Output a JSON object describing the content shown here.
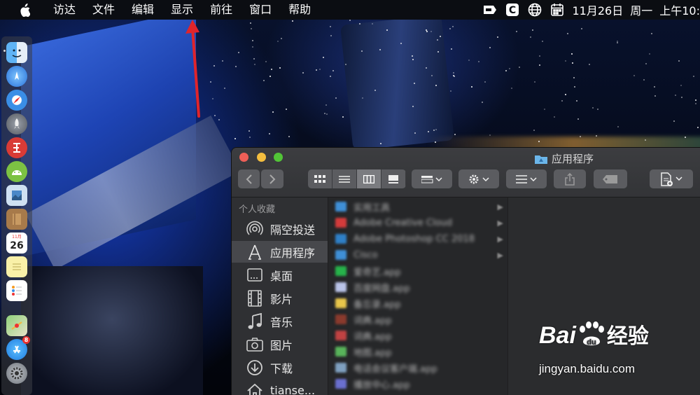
{
  "menubar": {
    "apple_icon": "apple-logo-icon",
    "items": [
      "访达",
      "文件",
      "编辑",
      "显示",
      "前往",
      "窗口",
      "帮助"
    ],
    "status_icons": [
      "notification-icon",
      "c-app-icon",
      "globe-icon",
      "calendar-icon"
    ],
    "date": "11月26日",
    "weekday": "周一",
    "time": "上午10:"
  },
  "dock": {
    "items": [
      "finder",
      "app-store-alt",
      "safari",
      "launchpad",
      "xmind",
      "android-studio",
      "preview",
      "notes-brown",
      "calendar",
      "stickies",
      "reminders",
      "maps",
      "app-store",
      "system-preferences"
    ],
    "calendar_day": "26",
    "calendar_month": "11月",
    "app_store_badge": "8"
  },
  "finder": {
    "title": "应用程序",
    "sidebar_header": "个人收藏",
    "sidebar": [
      {
        "label": "隔空投送",
        "icon": "airdrop-icon"
      },
      {
        "label": "应用程序",
        "icon": "applications-icon",
        "selected": true
      },
      {
        "label": "桌面",
        "icon": "desktop-icon"
      },
      {
        "label": "影片",
        "icon": "movies-icon"
      },
      {
        "label": "音乐",
        "icon": "music-icon"
      },
      {
        "label": "图片",
        "icon": "pictures-icon"
      },
      {
        "label": "下载",
        "icon": "downloads-icon"
      },
      {
        "label": "tianse...",
        "icon": "home-icon"
      }
    ],
    "files": [
      {
        "name": "实用工具",
        "color": "#3f8fd6",
        "folder": true
      },
      {
        "name": "Adobe Creative Cloud",
        "color": "#d33b3b",
        "folder": true
      },
      {
        "name": "Adobe Photoshop CC 2018",
        "color": "#2f7fc6",
        "folder": true
      },
      {
        "name": "Cisco",
        "color": "#3f8fd6",
        "folder": true
      },
      {
        "name": "爱奇艺.app",
        "color": "#27b34a",
        "folder": false
      },
      {
        "name": "百度网盘.app",
        "color": "#b9c3e8",
        "folder": false
      },
      {
        "name": "备忘录.app",
        "color": "#e8c64a",
        "folder": false
      },
      {
        "name": "词典.app",
        "color": "#8a3a2d",
        "folder": false
      },
      {
        "name": "词典.app",
        "color": "#c04242",
        "folder": false
      },
      {
        "name": "地图.app",
        "color": "#58b35a",
        "folder": false
      },
      {
        "name": "电话会议客户端.app",
        "color": "#7fa0c0",
        "folder": false
      },
      {
        "name": "播放中心.app",
        "color": "#6a6fcf",
        "folder": false
      }
    ]
  },
  "watermark": {
    "logo": "Bai",
    "logo_suffix": "经验",
    "url": "jingyan.baidu.com"
  }
}
